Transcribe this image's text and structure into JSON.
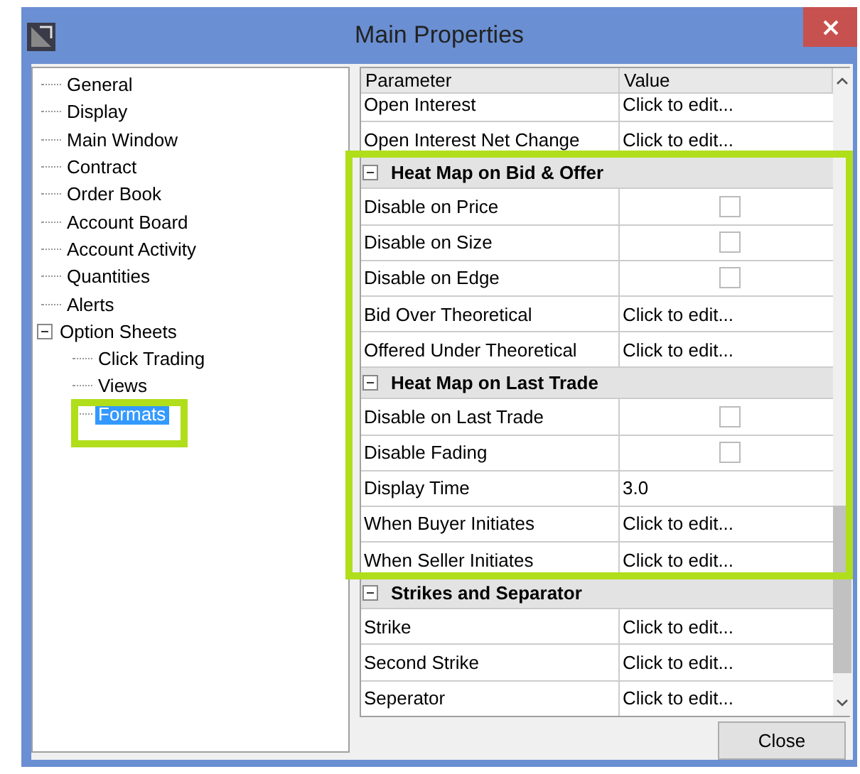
{
  "window": {
    "title": "Main Properties"
  },
  "tree": [
    {
      "label": "General",
      "selected": false
    },
    {
      "label": "Display",
      "selected": false
    },
    {
      "label": "Main Window",
      "selected": false
    },
    {
      "label": "Contract",
      "selected": false
    },
    {
      "label": "Order Book",
      "selected": false
    },
    {
      "label": "Account Board",
      "selected": false
    },
    {
      "label": "Account Activity",
      "selected": false
    },
    {
      "label": "Quantities",
      "selected": false
    },
    {
      "label": "Alerts",
      "selected": false
    },
    {
      "label": "Option Sheets",
      "selected": false,
      "expanded": true,
      "children": [
        {
          "label": "Click Trading",
          "selected": false
        },
        {
          "label": "Views",
          "selected": false
        },
        {
          "label": "Formats",
          "selected": true
        }
      ]
    }
  ],
  "grid": {
    "columns": [
      "Parameter",
      "Value"
    ],
    "groups": [
      {
        "rows": [
          {
            "kind": "text",
            "name": "Open Interest",
            "value": "Click to edit..."
          },
          {
            "kind": "text",
            "name": "Open Interest Net Change",
            "value": "Click to edit..."
          }
        ]
      },
      {
        "title": "Heat Map on Bid & Offer",
        "expanded": true,
        "rows": [
          {
            "kind": "checkbox",
            "name": "Disable on Price",
            "checked": false
          },
          {
            "kind": "checkbox",
            "name": "Disable on Size",
            "checked": false
          },
          {
            "kind": "checkbox",
            "name": "Disable on Edge",
            "checked": false
          },
          {
            "kind": "text",
            "name": "Bid Over Theoretical",
            "value": "Click to edit..."
          },
          {
            "kind": "text",
            "name": "Offered Under Theoretical",
            "value": "Click to edit..."
          }
        ]
      },
      {
        "title": "Heat Map on Last Trade",
        "expanded": true,
        "rows": [
          {
            "kind": "checkbox",
            "name": "Disable on Last Trade",
            "checked": false
          },
          {
            "kind": "checkbox",
            "name": "Disable Fading",
            "checked": false
          },
          {
            "kind": "text",
            "name": "Display Time",
            "value": "3.0"
          },
          {
            "kind": "text",
            "name": "When Buyer Initiates",
            "value": "Click to edit..."
          },
          {
            "kind": "text",
            "name": "When Seller Initiates",
            "value": "Click to edit..."
          }
        ]
      },
      {
        "title": "Strikes and Separator",
        "expanded": true,
        "rows": [
          {
            "kind": "text",
            "name": "Strike",
            "value": "Click to edit..."
          },
          {
            "kind": "text",
            "name": "Second Strike",
            "value": "Click to edit..."
          },
          {
            "kind": "text",
            "name": "Seperator",
            "value": "Click to edit..."
          }
        ]
      }
    ]
  },
  "buttons": [
    "Close"
  ]
}
